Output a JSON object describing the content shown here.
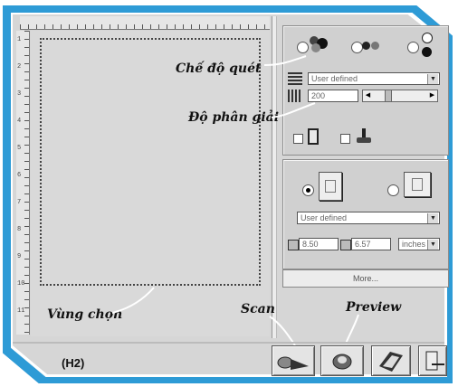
{
  "labels": {
    "scan_mode": "Chế độ quét",
    "resolution": "Độ phân giải",
    "selection_area": "Vùng chọn",
    "scan": "Scan",
    "preview": "Preview",
    "figure_id": "(H2)"
  },
  "ruler_left_marks": [
    "1",
    "2",
    "3",
    "4",
    "5",
    "6",
    "7",
    "8",
    "9",
    "10",
    "11"
  ],
  "scan_settings": {
    "mode_select": "User defined",
    "resolution_value": "200"
  },
  "output": {
    "size_select": "User defined",
    "width_value": "8.50",
    "height_value": "6.57",
    "units_select": "inches",
    "more_button": "More..."
  },
  "icons": {
    "scan": "scanner-icon",
    "preview": "preview-scanner-icon",
    "help": "help-book-icon",
    "exit": "exit-icon"
  },
  "colors": {
    "frame": "#2e9bd6",
    "window": "#d6d6d6"
  }
}
